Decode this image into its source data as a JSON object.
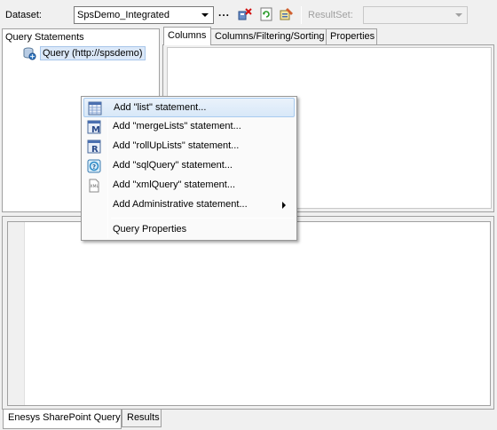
{
  "toolbar": {
    "dataset_label": "Dataset:",
    "dataset_value": "SpsDemo_Integrated",
    "ellipsis": "...",
    "resultset_label": "ResultSet:",
    "resultset_value": ""
  },
  "left_panel": {
    "header": "Query Statements",
    "tree": [
      {
        "label": "Query (http://spsdemo)",
        "icon": "database-icon"
      }
    ]
  },
  "tabs": [
    {
      "label": "Columns",
      "active": true
    },
    {
      "label": "Columns/Filtering/Sorting",
      "active": false
    },
    {
      "label": "Properties",
      "active": false
    }
  ],
  "context_menu": {
    "items": [
      {
        "label": "Add \"list\" statement...",
        "icon": "list-icon",
        "highlighted": true
      },
      {
        "label": "Add \"mergeLists\" statement...",
        "icon": "merge-lists-icon"
      },
      {
        "label": "Add \"rollUpLists\" statement...",
        "icon": "rollup-lists-icon"
      },
      {
        "label": "Add \"sqlQuery\" statement...",
        "icon": "sql-query-icon"
      },
      {
        "label": "Add \"xmlQuery\" statement...",
        "icon": "xml-query-icon"
      },
      {
        "label": "Add Administrative statement...",
        "icon": "",
        "submenu": true
      },
      {
        "label": "Query Properties",
        "icon": ""
      }
    ]
  },
  "bottom_tabs": [
    {
      "label": "Enesys SharePoint Query",
      "active": true
    },
    {
      "label": "Results",
      "active": false
    }
  ]
}
